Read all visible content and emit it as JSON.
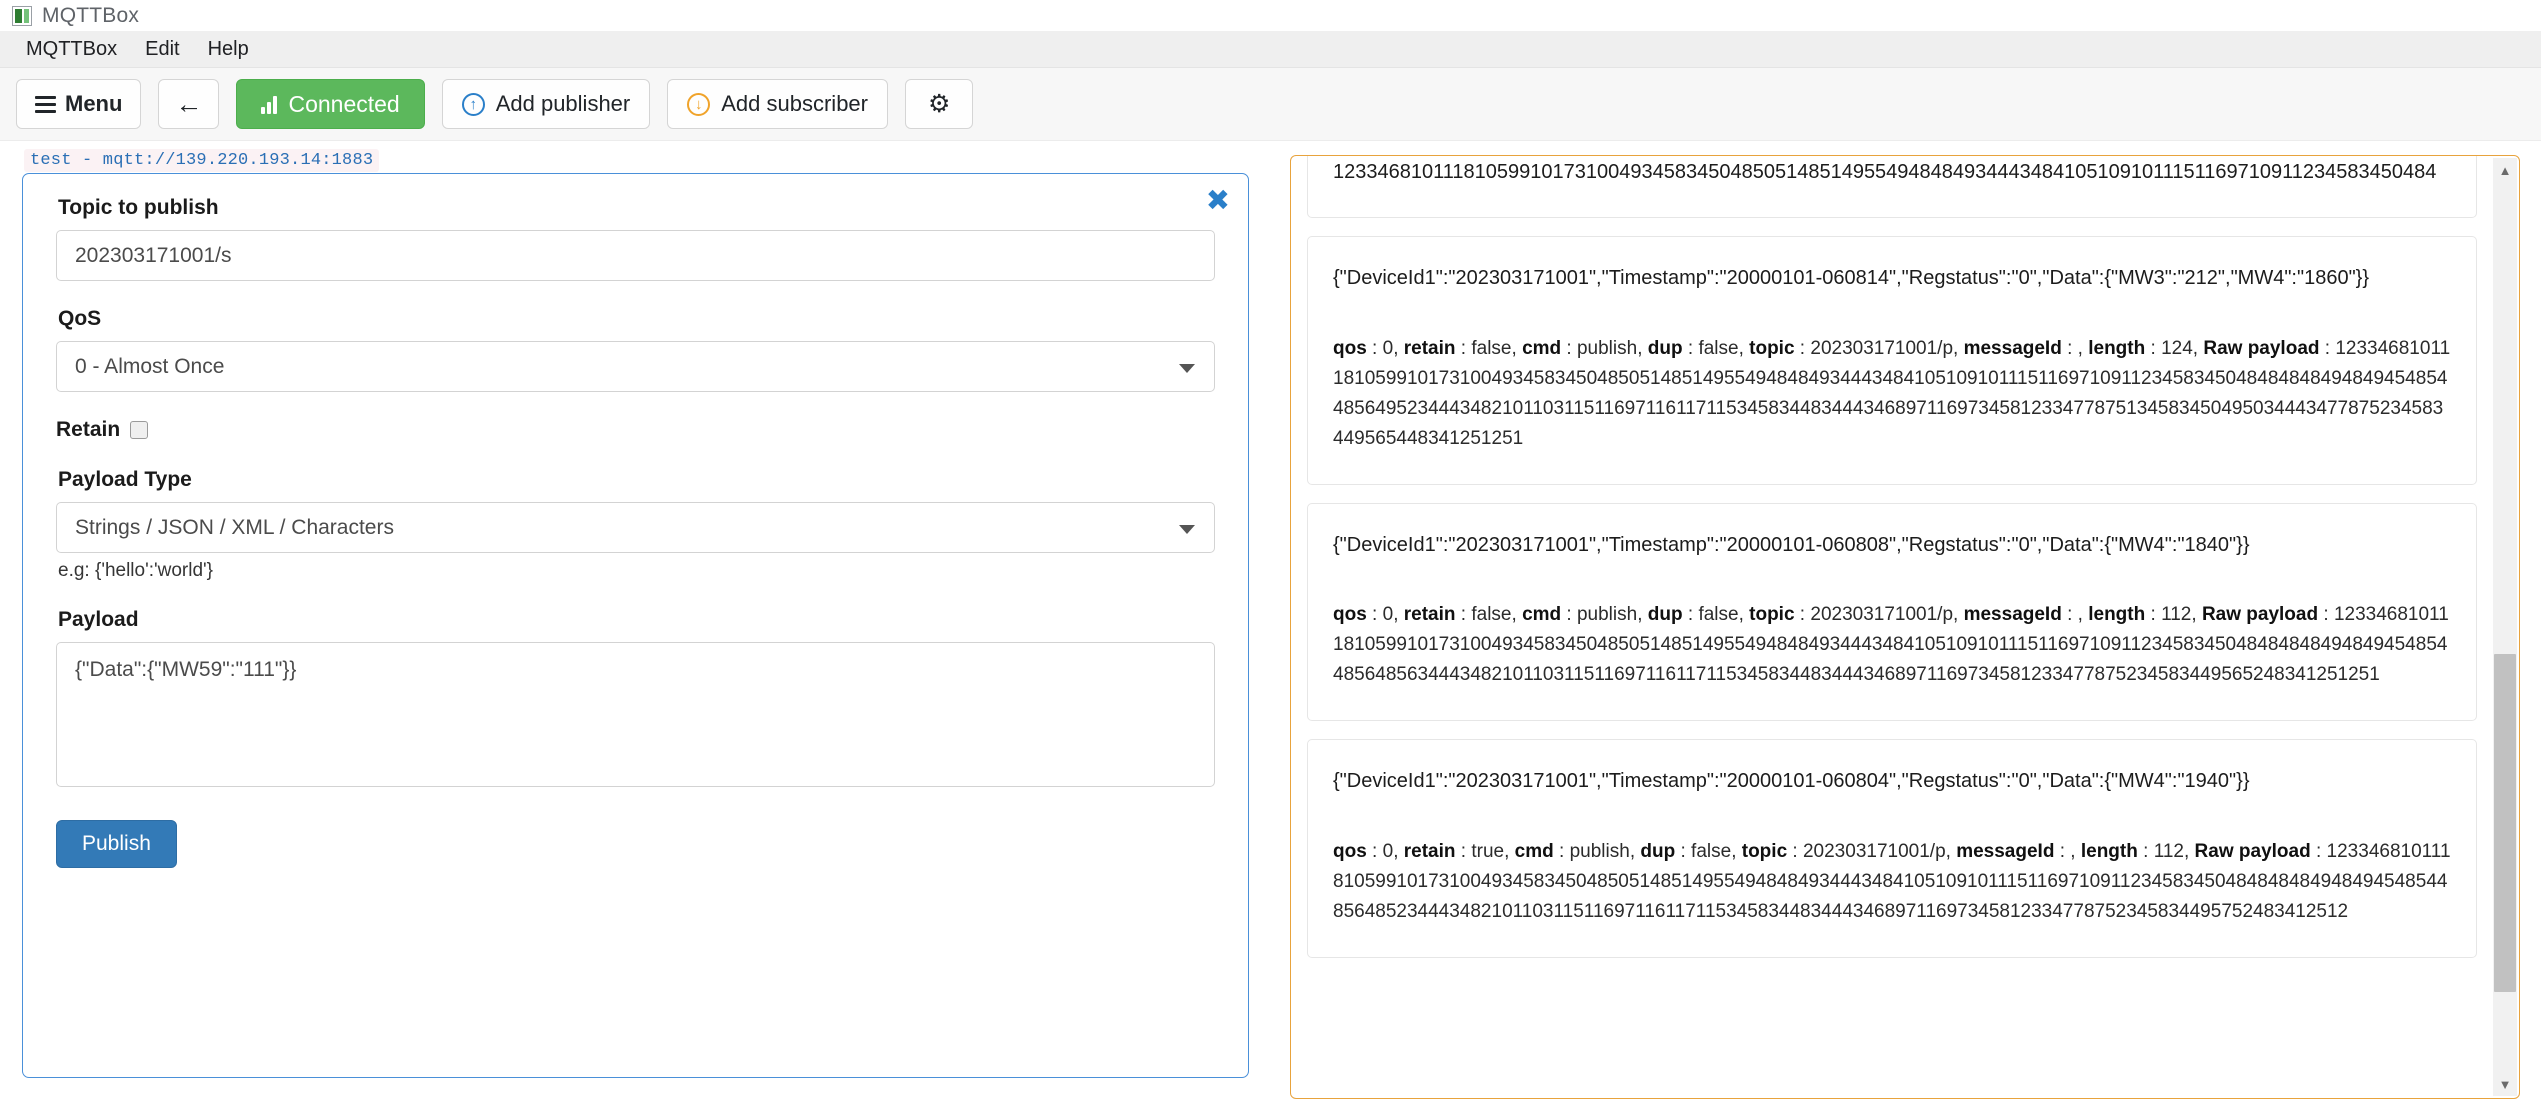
{
  "window": {
    "title": "MQTTBox",
    "icon": "app-icon"
  },
  "menubar": {
    "items": [
      {
        "label": "MQTTBox"
      },
      {
        "label": "Edit"
      },
      {
        "label": "Help"
      }
    ]
  },
  "toolbar": {
    "menu_label": "Menu",
    "back_icon": "←",
    "connected_label": "Connected",
    "add_publisher_label": "Add publisher",
    "add_subscriber_label": "Add subscriber",
    "publisher_icon_glyph": "↑",
    "subscriber_icon_glyph": "↓",
    "gear_glyph": "⚙",
    "connected_color": "#5cb85c",
    "publisher_icon_color": "#2a7fc9",
    "subscriber_icon_color": "#f0a32a"
  },
  "connection": {
    "label": "test - mqtt://139.220.193.14:1883"
  },
  "publisher": {
    "close_glyph": "✖",
    "topic_label": "Topic to publish",
    "topic_value": "202303171001/s",
    "qos_label": "QoS",
    "qos_value": "0 - Almost Once",
    "retain_label": "Retain",
    "retain_checked": false,
    "payload_type_label": "Payload Type",
    "payload_type_value": "Strings / JSON / XML / Characters",
    "payload_hint": "e.g: {'hello':'world'}",
    "payload_label": "Payload",
    "payload_value": "{\"Data\":{\"MW59\":\"111\"}}",
    "publish_button": "Publish",
    "border_color": "#4a90d9"
  },
  "messages": {
    "border_color": "#e8a33d",
    "scroll_up_glyph": "▲",
    "scroll_down_glyph": "▼",
    "items": [
      {
        "clipped": true,
        "body": "1233468101118105991017310049345834504850514851495549484849344434841051091011151169710911234583450484",
        "meta": ""
      },
      {
        "clipped": false,
        "body": "{\"DeviceId1\":\"202303171001\",\"Timestamp\":\"20000101-060814\",\"Regstatus\":\"0\",\"Data\":{\"MW3\":\"212\",\"MW4\":\"1860\"}}",
        "meta_qos_key": "qos",
        "meta_qos": "0",
        "meta_retain_key": "retain",
        "meta_retain": "false",
        "meta_cmd_key": "cmd",
        "meta_cmd": "publish",
        "meta_dup_key": "dup",
        "meta_dup": "false",
        "meta_topic_key": "topic",
        "meta_topic": "202303171001/p",
        "meta_messageid_key": "messageId",
        "meta_messageid": "",
        "meta_length_key": "length",
        "meta_length": "124",
        "meta_rawpayload_key": "Raw payload",
        "meta_rawpayload": "1233468101118105991017310049345834504850514851495549484849344434841051091011151169710911234583450484848484948494548544856495234443482101103115116971161171153458344834443468971169734581233477875134583450495034443477875234583449565448341251251"
      },
      {
        "clipped": false,
        "body": "{\"DeviceId1\":\"202303171001\",\"Timestamp\":\"20000101-060808\",\"Regstatus\":\"0\",\"Data\":{\"MW4\":\"1840\"}}",
        "meta_qos_key": "qos",
        "meta_qos": "0",
        "meta_retain_key": "retain",
        "meta_retain": "false",
        "meta_cmd_key": "cmd",
        "meta_cmd": "publish",
        "meta_dup_key": "dup",
        "meta_dup": "false",
        "meta_topic_key": "topic",
        "meta_topic": "202303171001/p",
        "meta_messageid_key": "messageId",
        "meta_messageid": "",
        "meta_length_key": "length",
        "meta_length": "112",
        "meta_rawpayload_key": "Raw payload",
        "meta_rawpayload": "1233468101118105991017310049345834504850514851495549484849344434841051091011151169710911234583450484848484948494548544856485634443482101103115116971161171153458344834443468971169734581233477875234583449565248341251251"
      },
      {
        "clipped": false,
        "body": "{\"DeviceId1\":\"202303171001\",\"Timestamp\":\"20000101-060804\",\"Regstatus\":\"0\",\"Data\":{\"MW4\":\"1940\"}}",
        "meta_qos_key": "qos",
        "meta_qos": "0",
        "meta_retain_key": "retain",
        "meta_retain": "true",
        "meta_cmd_key": "cmd",
        "meta_cmd": "publish",
        "meta_dup_key": "dup",
        "meta_dup": "false",
        "meta_topic_key": "topic",
        "meta_topic": "202303171001/p",
        "meta_messageid_key": "messageId",
        "meta_messageid": "",
        "meta_length_key": "length",
        "meta_length": "112",
        "meta_rawpayload_key": "Raw payload",
        "meta_rawpayload": "12334681011181059910173100493458345048505148514955494848493444348410510910111511697109112345834504848484849484945485448564852344434821011031151169711611711534583448344434689711697345812334778752345834495752483412512"
      }
    ]
  }
}
